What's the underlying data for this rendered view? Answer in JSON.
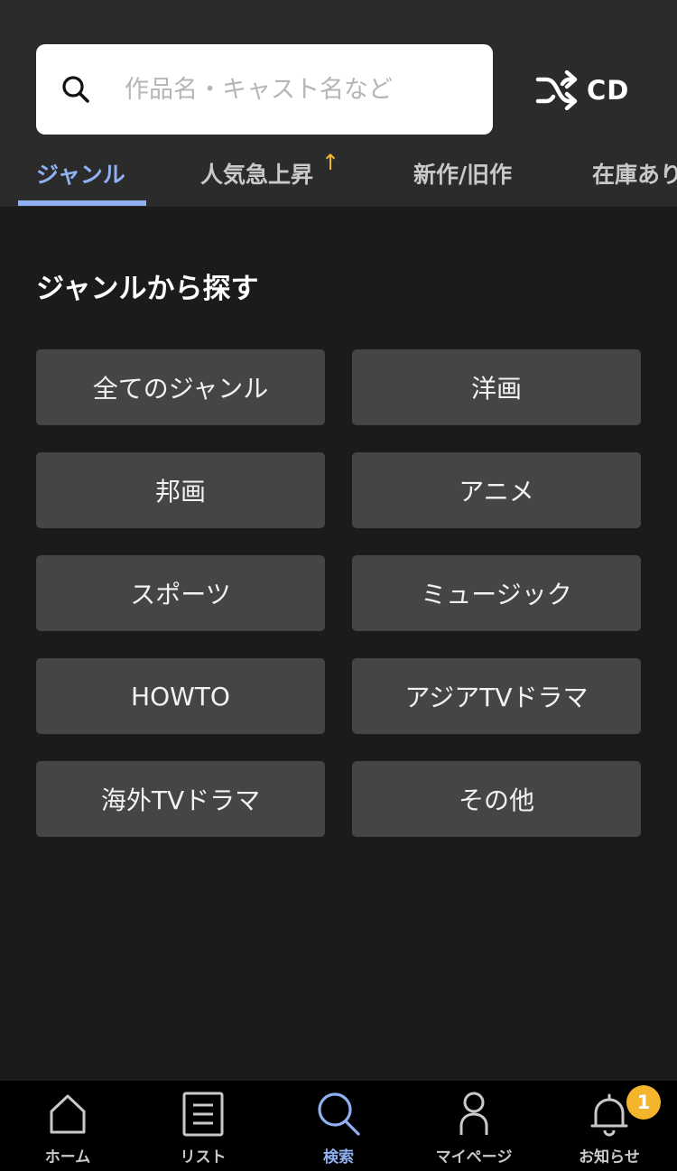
{
  "search": {
    "placeholder": "作品名・キャスト名など"
  },
  "mode_toggle": {
    "label": "CD",
    "icon": "shuffle-icon"
  },
  "tabs": [
    {
      "label": "ジャンル",
      "active": true
    },
    {
      "label": "人気急上昇",
      "badge_icon": "↑"
    },
    {
      "label": "新作/旧作"
    },
    {
      "label": "在庫あり"
    }
  ],
  "section": {
    "title": "ジャンルから探す"
  },
  "genres": [
    "全てのジャンル",
    "洋画",
    "邦画",
    "アニメ",
    "スポーツ",
    "ミュージック",
    "HOWTO",
    "アジアTVドラマ",
    "海外TVドラマ",
    "その他"
  ],
  "bottom_nav": [
    {
      "label": "ホーム",
      "icon": "home-icon"
    },
    {
      "label": "リスト",
      "icon": "list-icon"
    },
    {
      "label": "検索",
      "icon": "search-icon",
      "active": true
    },
    {
      "label": "マイページ",
      "icon": "user-icon"
    },
    {
      "label": "お知らせ",
      "icon": "bell-icon",
      "badge": "1"
    }
  ],
  "colors": {
    "accent": "#8fb1f2",
    "badge": "#f4b52c",
    "trend_arrow": "#f1b82e"
  }
}
